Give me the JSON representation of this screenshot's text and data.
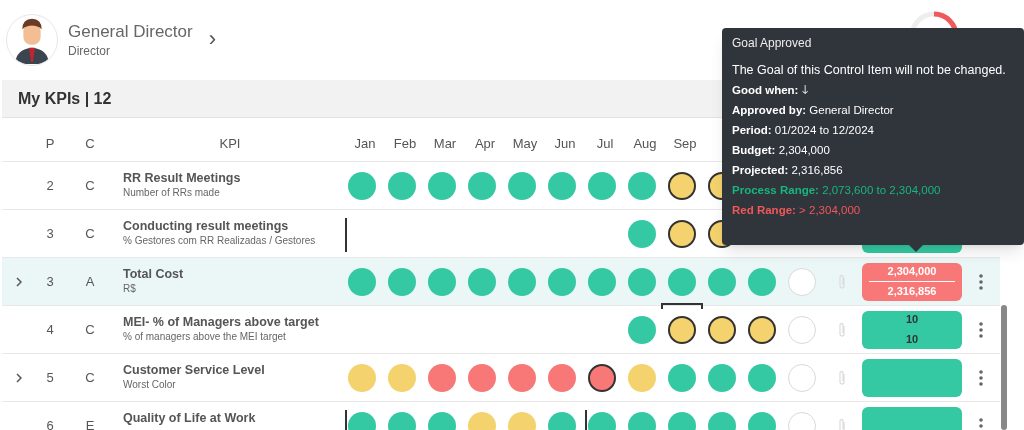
{
  "profile": {
    "name": "General Director",
    "role": "Director",
    "chevron": "›"
  },
  "section": {
    "title": "My KPIs | 12"
  },
  "columns": {
    "p": "P",
    "c": "C",
    "kpi": "KPI",
    "months": [
      "Jan",
      "Feb",
      "Mar",
      "Apr",
      "May",
      "Jun",
      "Jul",
      "Aug",
      "Sep"
    ]
  },
  "rows": [
    {
      "expandable": false,
      "selected": false,
      "p": "2",
      "c": "C",
      "title": "RR Result Meetings",
      "subtitle": "Number of RRs made",
      "months": [
        {
          "kind": "dot",
          "color": "#34c9a3",
          "outlined": false
        },
        {
          "kind": "dot",
          "color": "#34c9a3",
          "outlined": false
        },
        {
          "kind": "dot",
          "color": "#34c9a3",
          "outlined": false
        },
        {
          "kind": "dot",
          "color": "#34c9a3",
          "outlined": false
        },
        {
          "kind": "dot",
          "color": "#34c9a3",
          "outlined": false
        },
        {
          "kind": "dot",
          "color": "#34c9a3",
          "outlined": false
        },
        {
          "kind": "dot",
          "color": "#34c9a3",
          "outlined": false
        },
        {
          "kind": "dot",
          "color": "#34c9a3",
          "outlined": false
        },
        {
          "kind": "dot",
          "color": "#f4d36e",
          "outlined": true
        },
        {
          "kind": "dot",
          "color": "#f4d36e",
          "outlined": true
        }
      ]
    },
    {
      "expandable": false,
      "selected": false,
      "p": "3",
      "c": "C",
      "title": "Conducting result meetings",
      "subtitle": "% Gestores com RR Realizadas / Gestores",
      "box": {
        "color": "#34c9a3"
      },
      "months": [
        {
          "kind": "marker"
        },
        {
          "kind": "blank"
        },
        {
          "kind": "blank"
        },
        {
          "kind": "blank"
        },
        {
          "kind": "blank"
        },
        {
          "kind": "blank"
        },
        {
          "kind": "blank"
        },
        {
          "kind": "blank"
        },
        {
          "kind": "dot",
          "color": "#34c9a3",
          "outlined": false
        },
        {
          "kind": "dot",
          "color": "#f4d36e",
          "outlined": true
        },
        {
          "kind": "dot",
          "color": "#f4d36e",
          "outlined": true
        }
      ]
    },
    {
      "expandable": true,
      "selected": true,
      "p": "3",
      "c": "A",
      "title": "Total Cost",
      "subtitle": "R$",
      "box": {
        "color": "#f87878",
        "lines": [
          "2,304,000",
          "2,316,856"
        ]
      },
      "months": [
        {
          "kind": "dot",
          "color": "#34c9a3",
          "outlined": false
        },
        {
          "kind": "dot",
          "color": "#34c9a3",
          "outlined": false
        },
        {
          "kind": "dot",
          "color": "#34c9a3",
          "outlined": false
        },
        {
          "kind": "dot",
          "color": "#34c9a3",
          "outlined": false
        },
        {
          "kind": "dot",
          "color": "#34c9a3",
          "outlined": false
        },
        {
          "kind": "dot",
          "color": "#34c9a3",
          "outlined": false
        },
        {
          "kind": "dot",
          "color": "#34c9a3",
          "outlined": false
        },
        {
          "kind": "dot",
          "color": "#34c9a3",
          "outlined": false
        },
        {
          "kind": "dot",
          "color": "#34c9a3",
          "outlined": false
        },
        {
          "kind": "bracket"
        },
        {
          "kind": "dot",
          "color": "#34c9a3",
          "outlined": false
        },
        {
          "kind": "dot",
          "color": "#34c9a3",
          "outlined": false
        },
        {
          "kind": "dot",
          "color": "#ffffff",
          "outlined": false
        }
      ]
    },
    {
      "expandable": false,
      "selected": false,
      "p": "4",
      "c": "C",
      "title": "MEI- % of Managers above target",
      "subtitle": "% of managers above the MEI target",
      "box": {
        "color": "#34c9a3",
        "lines": [
          "10",
          "10"
        ]
      },
      "months": [
        {
          "kind": "blank"
        },
        {
          "kind": "blank"
        },
        {
          "kind": "blank"
        },
        {
          "kind": "blank"
        },
        {
          "kind": "blank"
        },
        {
          "kind": "blank"
        },
        {
          "kind": "blank"
        },
        {
          "kind": "dot",
          "color": "#34c9a3",
          "outlined": false
        },
        {
          "kind": "dot",
          "color": "#f4d36e",
          "outlined": true
        },
        {
          "kind": "dot",
          "color": "#f4d36e",
          "outlined": true
        },
        {
          "kind": "dot",
          "color": "#f4d36e",
          "outlined": true
        },
        {
          "kind": "dot",
          "color": "#ffffff",
          "outlined": false
        }
      ]
    },
    {
      "expandable": true,
      "selected": false,
      "p": "5",
      "c": "C",
      "title": "Customer Service Level",
      "subtitle": "Worst Color",
      "box": {
        "color": "#34c9a3"
      },
      "months": [
        {
          "kind": "dot",
          "color": "#f4d36e",
          "outlined": false
        },
        {
          "kind": "dot",
          "color": "#f4d36e",
          "outlined": false
        },
        {
          "kind": "dot",
          "color": "#f87878",
          "outlined": false
        },
        {
          "kind": "dot",
          "color": "#f87878",
          "outlined": false
        },
        {
          "kind": "dot",
          "color": "#f87878",
          "outlined": false
        },
        {
          "kind": "dot",
          "color": "#f87878",
          "outlined": false
        },
        {
          "kind": "dot",
          "color": "#f87878",
          "outlined": true
        },
        {
          "kind": "dot",
          "color": "#f4d36e",
          "outlined": false
        },
        {
          "kind": "dot",
          "color": "#34c9a3",
          "outlined": false
        },
        {
          "kind": "dot",
          "color": "#34c9a3",
          "outlined": false
        },
        {
          "kind": "dot",
          "color": "#34c9a3",
          "outlined": false
        },
        {
          "kind": "dot",
          "color": "#ffffff",
          "outlined": false
        }
      ]
    },
    {
      "expandable": false,
      "selected": false,
      "p": "6",
      "c": "E",
      "title": "Quality of Life at Work",
      "box": {
        "color": "#34c9a3"
      },
      "months": [
        {
          "kind": "marker"
        },
        {
          "kind": "dot",
          "color": "#34c9a3",
          "outlined": false
        },
        {
          "kind": "dot",
          "color": "#34c9a3",
          "outlined": false
        },
        {
          "kind": "dot",
          "color": "#34c9a3",
          "outlined": false
        },
        {
          "kind": "dot",
          "color": "#f4d36e",
          "outlined": false
        },
        {
          "kind": "dot",
          "color": "#f4d36e",
          "outlined": false
        },
        {
          "kind": "dot",
          "color": "#34c9a3",
          "outlined": false
        },
        {
          "kind": "marker"
        },
        {
          "kind": "dot",
          "color": "#34c9a3",
          "outlined": false
        },
        {
          "kind": "dot",
          "color": "#34c9a3",
          "outlined": false
        },
        {
          "kind": "dot",
          "color": "#34c9a3",
          "outlined": false
        },
        {
          "kind": "dot",
          "color": "#34c9a3",
          "outlined": false
        },
        {
          "kind": "dot",
          "color": "#34c9a3",
          "outlined": false
        },
        {
          "kind": "dot",
          "color": "#ffffff",
          "outlined": false
        }
      ]
    }
  ],
  "tooltip": {
    "title": "Goal Approved",
    "lines": [
      {
        "kind": "plain",
        "text": "The Goal of this Control Item will not be changed."
      },
      {
        "kind": "plain",
        "text": "**Good when:** 🡓"
      },
      {
        "kind": "plain",
        "text": "**Approved by:** General Director"
      },
      {
        "kind": "plain",
        "text": "**Period:** 01/2024 to 12/2024"
      },
      {
        "kind": "plain",
        "text": "**Budget:** 2,304,000"
      },
      {
        "kind": "plain",
        "text": "**Projected:** 2,316,856"
      },
      {
        "kind": "good",
        "text": "**Process Range:** 2,073,600 to 2,304,000"
      },
      {
        "kind": "bad",
        "text": "**Red Range:** > 2,304,000"
      }
    ]
  }
}
